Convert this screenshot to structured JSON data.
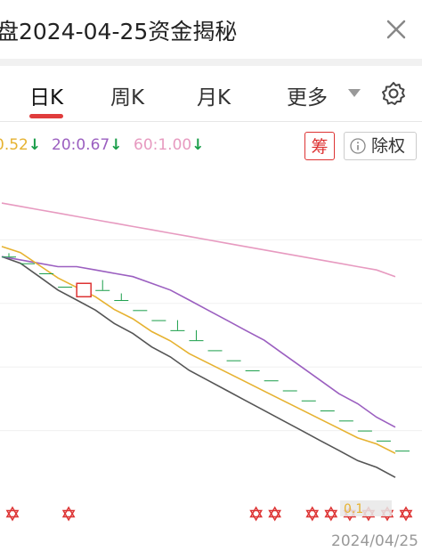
{
  "header": {
    "title": "盘2024-04-25资金揭秘",
    "close_icon": "close-icon"
  },
  "tabs": [
    {
      "label": "日K",
      "active": true
    },
    {
      "label": "周K",
      "active": false
    },
    {
      "label": "月K",
      "active": false
    },
    {
      "label": "更多",
      "active": false
    }
  ],
  "ma": {
    "ma5": "0.52",
    "ma20": "20:0.67",
    "ma60": "60:1.00",
    "arrow": "↓"
  },
  "chips": {
    "chou": "筹",
    "fuquan": "除权"
  },
  "footer": {
    "date": "2024/04/25"
  },
  "colors": {
    "accent": "#e03c3c",
    "ma5": "#e6b230",
    "ma20": "#9b5fc0",
    "ma60": "#e79ac0",
    "down": "#1a9e4a"
  },
  "chart_data": {
    "type": "line",
    "overlay_label": "0.1",
    "series": [
      {
        "name": "price",
        "values": [
          0.86,
          0.84,
          0.8,
          0.76,
          0.73,
          0.7,
          0.66,
          0.63,
          0.59,
          0.56,
          0.52,
          0.49,
          0.46,
          0.43,
          0.4,
          0.37,
          0.34,
          0.31,
          0.28,
          0.25,
          0.23,
          0.2
        ]
      },
      {
        "name": "20",
        "values": [
          0.86,
          0.85,
          0.84,
          0.83,
          0.83,
          0.82,
          0.81,
          0.8,
          0.78,
          0.76,
          0.73,
          0.7,
          0.67,
          0.64,
          0.61,
          0.57,
          0.53,
          0.49,
          0.45,
          0.42,
          0.38,
          0.35
        ]
      },
      {
        "name": "60",
        "values": [
          1.02,
          1.01,
          1.0,
          0.99,
          0.98,
          0.97,
          0.96,
          0.95,
          0.94,
          0.93,
          0.92,
          0.91,
          0.9,
          0.89,
          0.88,
          0.87,
          0.86,
          0.85,
          0.84,
          0.83,
          0.82,
          0.8
        ]
      }
    ],
    "candles": [
      {
        "o": 0.86,
        "c": 0.86,
        "h": 0.87,
        "l": 0.86
      },
      {
        "o": 0.84,
        "c": 0.84,
        "h": 0.84,
        "l": 0.84
      },
      {
        "o": 0.81,
        "c": 0.81,
        "h": 0.81,
        "l": 0.81
      },
      {
        "o": 0.77,
        "c": 0.77,
        "h": 0.77,
        "l": 0.77
      },
      {
        "o": 0.74,
        "c": 0.78,
        "h": 0.78,
        "l": 0.74
      },
      {
        "o": 0.76,
        "c": 0.76,
        "h": 0.79,
        "l": 0.76
      },
      {
        "o": 0.73,
        "c": 0.73,
        "h": 0.75,
        "l": 0.73
      },
      {
        "o": 0.7,
        "c": 0.7,
        "h": 0.7,
        "l": 0.7
      },
      {
        "o": 0.67,
        "c": 0.67,
        "h": 0.67,
        "l": 0.67
      },
      {
        "o": 0.64,
        "c": 0.64,
        "h": 0.67,
        "l": 0.64
      },
      {
        "o": 0.61,
        "c": 0.61,
        "h": 0.64,
        "l": 0.61
      },
      {
        "o": 0.58,
        "c": 0.58,
        "h": 0.58,
        "l": 0.58
      },
      {
        "o": 0.55,
        "c": 0.55,
        "h": 0.55,
        "l": 0.55
      },
      {
        "o": 0.52,
        "c": 0.52,
        "h": 0.52,
        "l": 0.52
      },
      {
        "o": 0.49,
        "c": 0.49,
        "h": 0.49,
        "l": 0.49
      },
      {
        "o": 0.46,
        "c": 0.46,
        "h": 0.46,
        "l": 0.46
      },
      {
        "o": 0.43,
        "c": 0.43,
        "h": 0.43,
        "l": 0.43
      },
      {
        "o": 0.4,
        "c": 0.4,
        "h": 0.4,
        "l": 0.4
      },
      {
        "o": 0.37,
        "c": 0.37,
        "h": 0.37,
        "l": 0.37
      },
      {
        "o": 0.34,
        "c": 0.34,
        "h": 0.34,
        "l": 0.34
      },
      {
        "o": 0.31,
        "c": 0.31,
        "h": 0.31,
        "l": 0.31
      },
      {
        "o": 0.28,
        "c": 0.28,
        "h": 0.28,
        "l": 0.28
      }
    ],
    "signal_indices": [
      0,
      3,
      13,
      14,
      16,
      17,
      18,
      19,
      20,
      21
    ],
    "ylim": [
      0.15,
      1.1
    ]
  }
}
